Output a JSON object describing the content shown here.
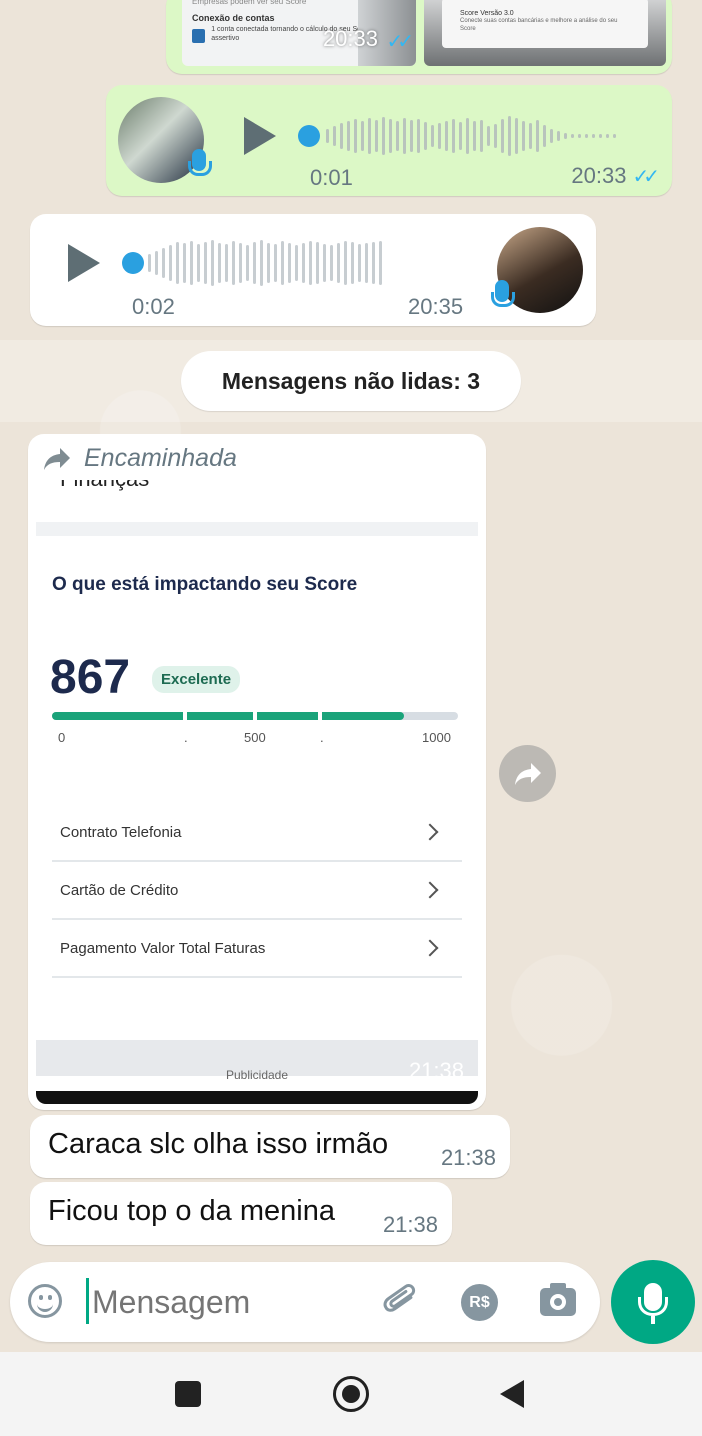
{
  "top_media": {
    "time": "20:33",
    "text": {
      "card1_heading": "Conexão de contas",
      "card1_line": "1 conta conectada",
      "card1_body": "tornando o cálculo do seu Score mais assertivo",
      "card1_top": "Empresas podem ver seu Score",
      "card2_heading": "Score Versão 3.0",
      "card2_body": "Conecte suas contas bancárias e melhore a análise do seu Score"
    }
  },
  "voice_out": {
    "duration": "0:01",
    "time": "20:33"
  },
  "voice_in": {
    "duration": "0:02",
    "time": "20:35"
  },
  "unread_banner": {
    "label": "Mensagens não lidas: 3"
  },
  "forwarded": {
    "label": "Encaminhada",
    "partial_heading": "Finanças",
    "section_title": "O que está impactando seu Score",
    "score": "867",
    "score_badge": "Excelente",
    "score_fraction": 0.867,
    "scale_labels": [
      "0",
      ".",
      "500",
      ".",
      "1000"
    ],
    "rows": [
      "Contrato Telefonia",
      "Cartão de Crédito",
      "Pagamento Valor Total Faturas"
    ],
    "ad_label": "Publicidade",
    "time": "21:38"
  },
  "messages": [
    {
      "text": "Caraca slc olha isso irmão",
      "time": "21:38"
    },
    {
      "text": "Ficou top o da menina",
      "time": "21:38"
    }
  ],
  "composer": {
    "placeholder": "Mensagem",
    "currency_label": "R$"
  },
  "colors": {
    "accent": "#00a884",
    "outgoing_bubble": "#dcf8c6",
    "read_ticks": "#34b7f1",
    "score_bar": "#1aa37a",
    "score_text": "#1d2a4d"
  },
  "icons": [
    "forward-icon",
    "emoji-icon",
    "attach-icon",
    "payment-icon",
    "camera-icon",
    "mic-icon",
    "play-icon",
    "nav-recents-icon",
    "nav-home-icon",
    "nav-back-icon"
  ]
}
